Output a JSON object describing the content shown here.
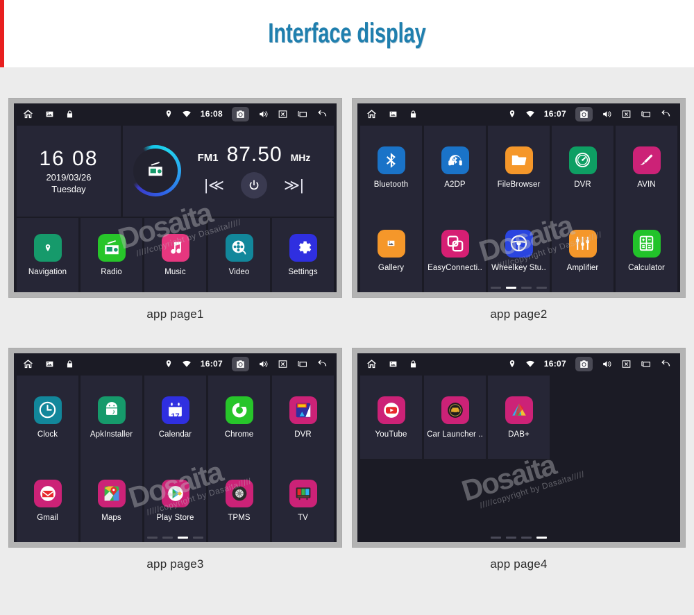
{
  "header": {
    "title": "Interface display",
    "accent_color": "#e81f1f",
    "title_color": "#1f7fae"
  },
  "watermark": {
    "big": "Dosaita",
    "small": "/////copyright by Dasaita/////"
  },
  "statusbar_icons": {
    "home": "home-icon",
    "gallery": "image-icon",
    "lock": "lock-icon",
    "location": "location-pin-icon",
    "wifi": "wifi-icon",
    "camera": "camera-icon",
    "volume": "volume-icon",
    "close": "close-box-icon",
    "recents": "recents-icon",
    "back": "back-arrow-icon"
  },
  "panels": [
    {
      "id": "page1",
      "caption": "app page1",
      "status": {
        "time": "16:08"
      },
      "home": {
        "clock": {
          "time": "16 08",
          "date": "2019/03/26",
          "day": "Tuesday"
        },
        "radio": {
          "band": "FM1",
          "frequency": "87.50",
          "unit": "MHz",
          "prev": "|≪",
          "next": "≫|",
          "power": "power-icon"
        }
      },
      "apps": [
        {
          "label": "Navigation",
          "icon": "location-pin-icon",
          "color": "#169a6b"
        },
        {
          "label": "Radio",
          "icon": "radio-icon",
          "color": "#27c52a"
        },
        {
          "label": "Music",
          "icon": "music-note-icon",
          "color": "#e6377f"
        },
        {
          "label": "Video",
          "icon": "film-reel-icon",
          "color": "#12879b"
        },
        {
          "label": "Settings",
          "icon": "gear-icon",
          "color": "#2f2fe0"
        }
      ],
      "dots": {
        "count": 0,
        "active": -1
      }
    },
    {
      "id": "page2",
      "caption": "app page2",
      "status": {
        "time": "16:07"
      },
      "apps": [
        {
          "label": "Bluetooth",
          "icon": "bluetooth-icon",
          "color": "#1a73c8"
        },
        {
          "label": "A2DP",
          "icon": "headset-bt-icon",
          "color": "#1a73c8"
        },
        {
          "label": "FileBrowser",
          "icon": "folder-icon",
          "color": "#f5972a"
        },
        {
          "label": "DVR",
          "icon": "gauge-icon",
          "color": "#0e9f63"
        },
        {
          "label": "AVIN",
          "icon": "plug-cable-icon",
          "color": "#cc2277"
        },
        {
          "label": "Gallery",
          "icon": "image-icon",
          "color": "#f5972a"
        },
        {
          "label": "EasyConnecti..",
          "icon": "screen-mirror-icon",
          "color": "#d61f73"
        },
        {
          "label": "Wheelkey Stu..",
          "icon": "steering-wheel-icon",
          "color": "#2a45e0"
        },
        {
          "label": "Amplifier",
          "icon": "equalizer-icon",
          "color": "#f5972a"
        },
        {
          "label": "Calculator",
          "icon": "calculator-icon",
          "color": "#22c32a"
        }
      ],
      "dots": {
        "count": 4,
        "active": 1
      }
    },
    {
      "id": "page3",
      "caption": "app page3",
      "status": {
        "time": "16:07"
      },
      "apps": [
        {
          "label": "Clock",
          "icon": "clock-icon",
          "color": "#12879b"
        },
        {
          "label": "ApkInstaller",
          "icon": "android-icon",
          "color": "#169a6b"
        },
        {
          "label": "Calendar",
          "icon": "calendar-icon",
          "color": "#2f2fe0",
          "badge": "17"
        },
        {
          "label": "Chrome",
          "icon": "chrome-icon",
          "color": "#27c52a"
        },
        {
          "label": "DVR",
          "icon": "rec-icon",
          "color": "#cc2277"
        },
        {
          "label": "Gmail",
          "icon": "gmail-icon",
          "color": "#cc2277"
        },
        {
          "label": "Maps",
          "icon": "maps-icon",
          "color": "#cc2277"
        },
        {
          "label": "Play Store",
          "icon": "play-store-icon",
          "color": "#cc2277"
        },
        {
          "label": "TPMS",
          "icon": "tire-icon",
          "color": "#cc2277"
        },
        {
          "label": "TV",
          "icon": "tv-icon",
          "color": "#cc2277"
        }
      ],
      "dots": {
        "count": 4,
        "active": 2
      }
    },
    {
      "id": "page4",
      "caption": "app page4",
      "status": {
        "time": "16:07"
      },
      "apps": [
        {
          "label": "YouTube",
          "icon": "youtube-icon",
          "color": "#cc2277"
        },
        {
          "label": "Car Launcher ..",
          "icon": "car-launcher-icon",
          "color": "#cc2277"
        },
        {
          "label": "DAB+",
          "icon": "dab-icon",
          "color": "#cc2277"
        }
      ],
      "dots": {
        "count": 4,
        "active": 3
      }
    }
  ]
}
